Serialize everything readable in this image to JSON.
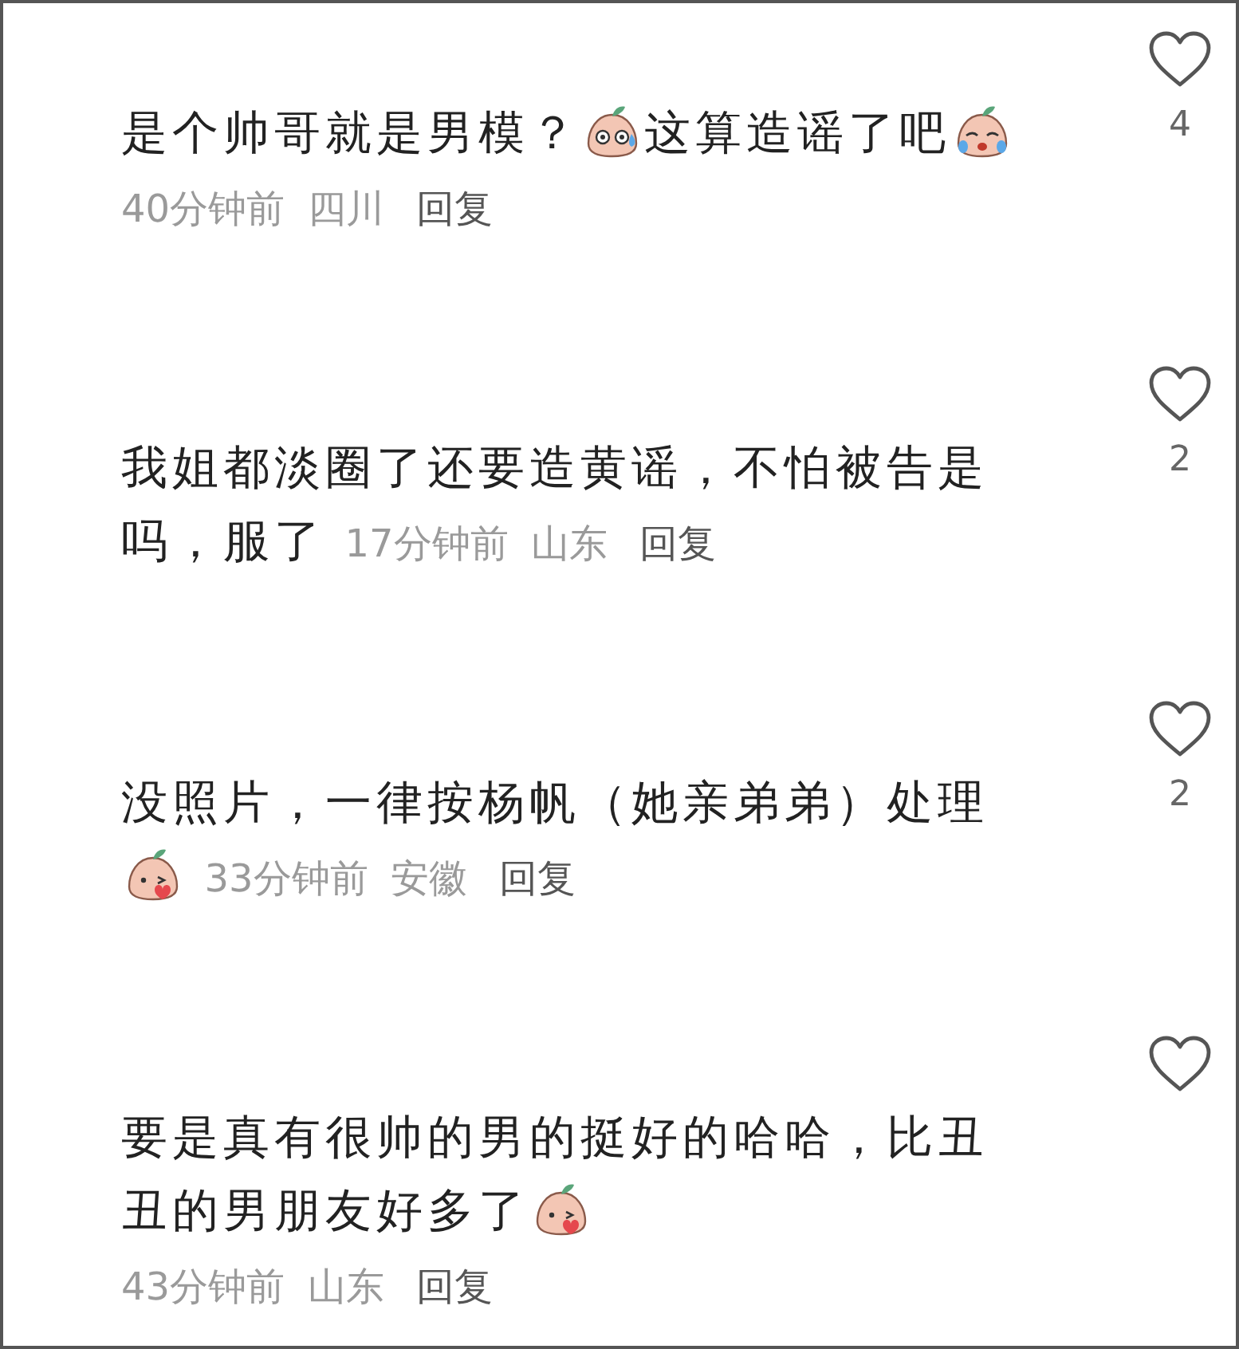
{
  "comments": [
    {
      "lines": [
        [
          {
            "kind": "text",
            "text": "是个帅哥就是男模？"
          },
          {
            "kind": "worried"
          },
          {
            "kind": "text",
            "text": "这算造谣了吧"
          },
          {
            "kind": "crying"
          }
        ]
      ],
      "meta_on_own_line": true,
      "time": "40分钟前",
      "location": "四川",
      "reply": "回复",
      "likes": "4"
    },
    {
      "lines": [
        [
          {
            "kind": "text",
            "text": "我姐都淡圈了还要造黄谣，不怕被告是"
          }
        ],
        [
          {
            "kind": "text",
            "text": "吗，服了"
          }
        ]
      ],
      "meta_on_own_line": false,
      "time": "17分钟前",
      "location": "山东",
      "reply": "回复",
      "likes": "2"
    },
    {
      "lines": [
        [
          {
            "kind": "text",
            "text": "没照片，一律按杨帆（她亲弟弟）处理"
          }
        ],
        [
          {
            "kind": "kiss"
          }
        ]
      ],
      "meta_on_own_line": false,
      "time": "33分钟前",
      "location": "安徽",
      "reply": "回复",
      "likes": "2"
    },
    {
      "lines": [
        [
          {
            "kind": "text",
            "text": "要是真有很帅的男的挺好的哈哈，比丑"
          }
        ],
        [
          {
            "kind": "text",
            "text": "丑的男朋友好多了"
          },
          {
            "kind": "kiss"
          }
        ]
      ],
      "meta_on_own_line": true,
      "time": "43分钟前",
      "location": "山东",
      "reply": "回复"
    }
  ]
}
